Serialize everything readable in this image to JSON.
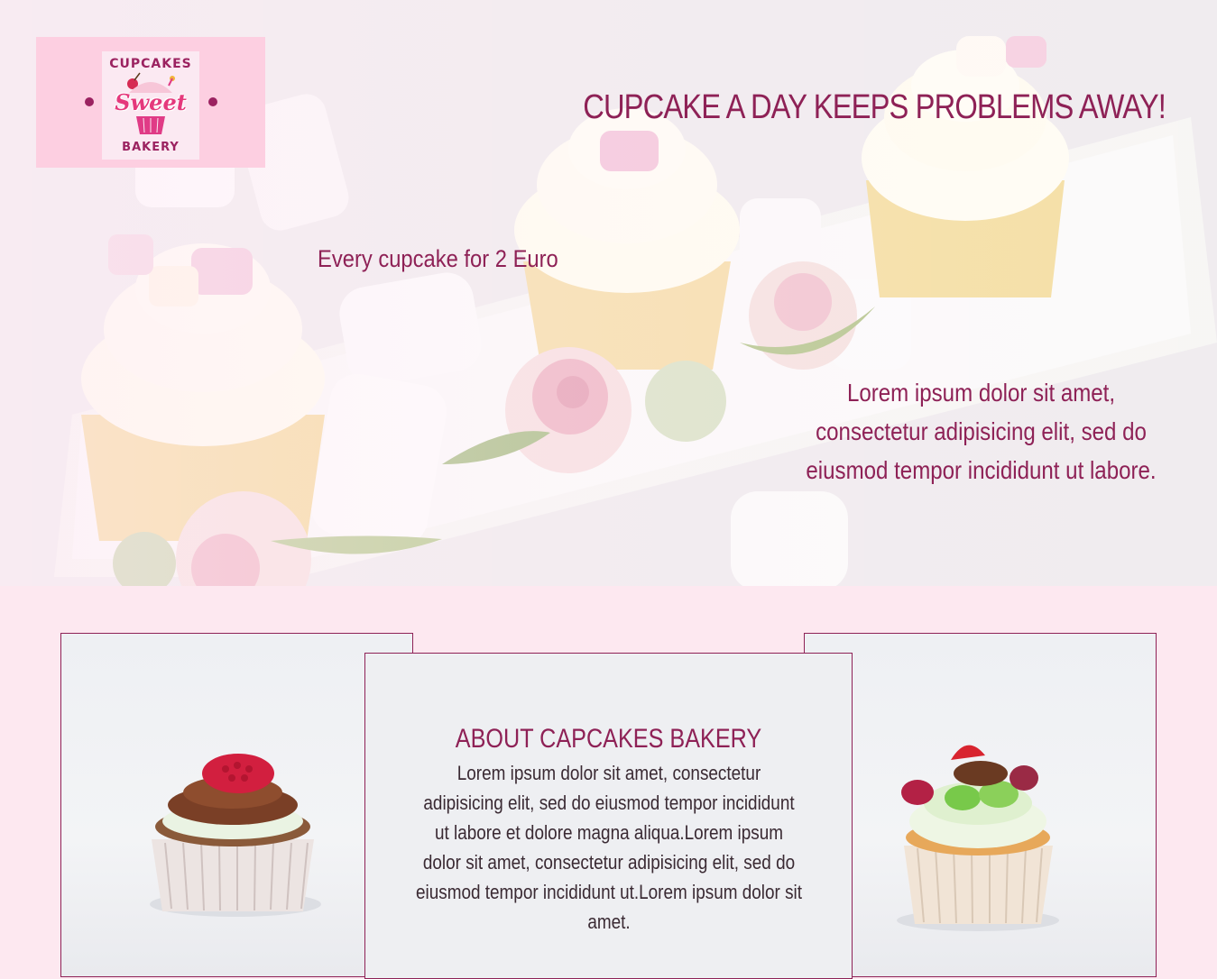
{
  "logo": {
    "top_text": "CUPCAKES",
    "middle_text": "Sweet",
    "bottom_text": "BAKERY"
  },
  "hero": {
    "headline": "CUPCAKE A DAY KEEPS PROBLEMS AWAY!",
    "price": "Every cupcake for 2 Euro",
    "description": "Lorem ipsum dolor sit amet, consectetur adipisicing elit, sed do eiusmod tempor incididunt ut labore."
  },
  "about": {
    "title": "ABOUT CAPCAKES BAKERY",
    "text": "Lorem ipsum dolor sit amet, consectetur adipisicing elit, sed do eiusmod tempor incididunt ut labore et dolore magna aliqua.Lorem ipsum dolor sit amet, consectetur adipisicing elit, sed do eiusmod tempor incididunt ut.Lorem ipsum dolor sit amet."
  },
  "colors": {
    "accent": "#8e2156",
    "background": "#fde8f0",
    "logo_background": "#fdcfe1"
  }
}
